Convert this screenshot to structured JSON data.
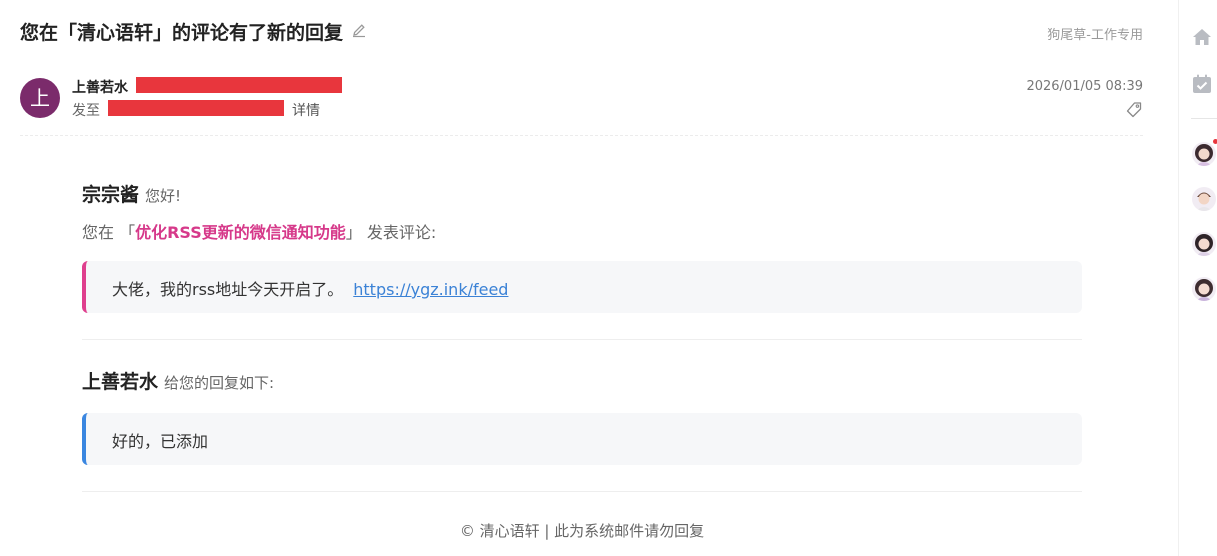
{
  "mail": {
    "subject": "您在「清心语轩」的评论有了新的回复",
    "folder": "狗尾草-工作专用",
    "sender": {
      "avatar_text": "上",
      "name": "上善若水",
      "to_prefix": "发至",
      "details": "详情",
      "timestamp": "2026/01/05 08:39"
    }
  },
  "body": {
    "greeting_name": "宗宗酱",
    "greeting_text": "您好!",
    "context_prefix": "您在 「",
    "post_title": "优化RSS更新的微信通知功能",
    "context_suffix": "」 发表评论:",
    "comment_text": "大佬，我的rss地址今天开启了。",
    "comment_link": "https://ygz.ink/feed",
    "replier_name": "上善若水",
    "reply_intro": "给您的回复如下:",
    "reply_text": "好的，已添加",
    "footer": "© 清心语轩 | 此为系统邮件请勿回复"
  },
  "colors": {
    "avatar_bg": "#7b2b6b",
    "pink_accent": "#df3f8e",
    "blue_accent": "#3a86e0",
    "link": "#3b82d6",
    "redaction": "#e8363d"
  },
  "sidebar": {
    "icons": [
      "home-icon",
      "calendar-check-icon"
    ],
    "contacts": [
      "contact-avatar-1",
      "contact-avatar-2",
      "contact-avatar-3",
      "contact-avatar-4"
    ]
  }
}
